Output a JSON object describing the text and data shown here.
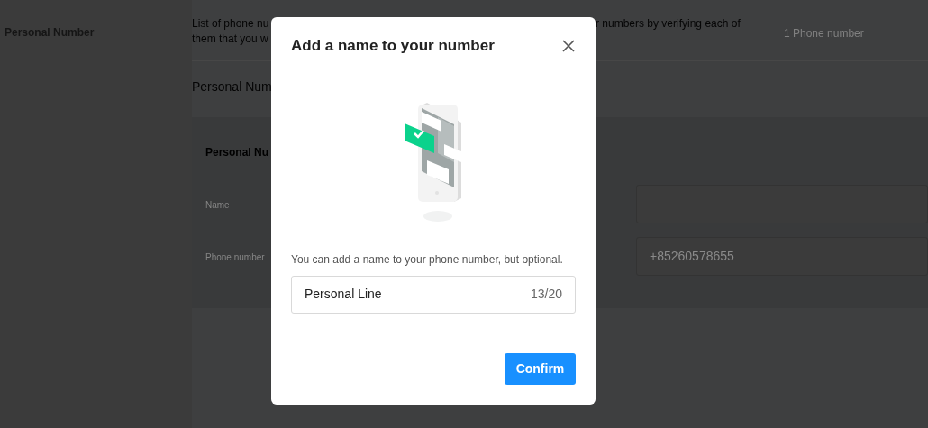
{
  "page": {
    "label": "Personal Number",
    "description_left": [
      "List of phone nu",
      "them that you w"
    ],
    "description_right": [
      "r numbers by verifying each of"
    ],
    "count": "1 Phone number",
    "section_title": "Personal Num",
    "card": {
      "title": "Personal Nu",
      "fields": [
        {
          "label": "Name"
        },
        {
          "label": "Phone number",
          "value": "+85260578655"
        }
      ]
    }
  },
  "dialog": {
    "title": "Add a name to your number",
    "caption": "You can add a name to your phone number, but optional.",
    "input": {
      "value": "Personal Line",
      "counter": "13/20"
    },
    "confirm": "Confirm"
  }
}
